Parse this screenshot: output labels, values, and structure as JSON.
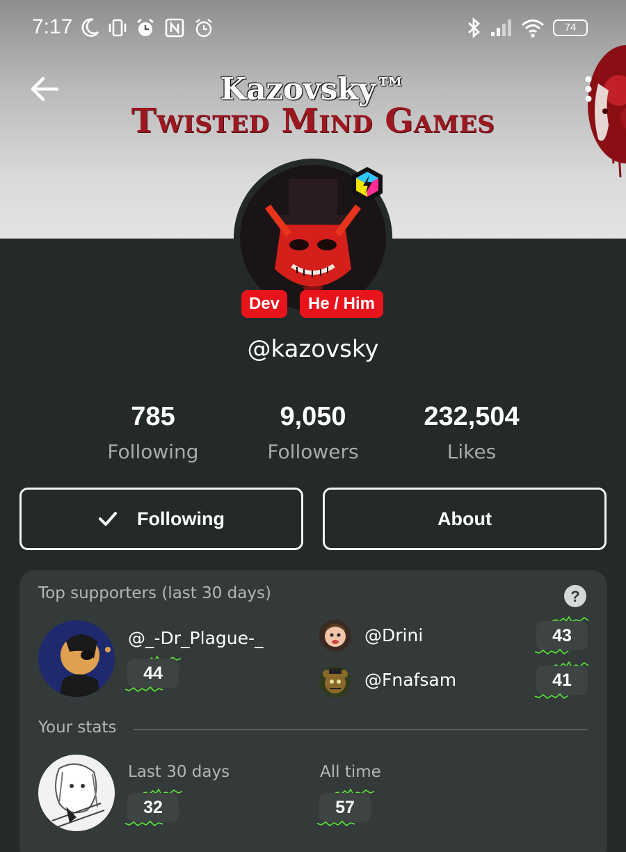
{
  "status_bar": {
    "time": "7:17",
    "battery": "74"
  },
  "banner": {
    "title": "Kazovsky™",
    "subtitle": "Twisted Mind Games"
  },
  "profile": {
    "tags": [
      "Dev",
      "He / Him"
    ],
    "handle": "@kazovsky"
  },
  "stats": [
    {
      "value": "785",
      "label": "Following"
    },
    {
      "value": "9,050",
      "label": "Followers"
    },
    {
      "value": "232,504",
      "label": "Likes"
    }
  ],
  "buttons": {
    "following": "Following",
    "about": "About"
  },
  "supporters": {
    "title": "Top supporters (last 30 days)",
    "top": {
      "name": "@_-Dr_Plague-_",
      "score": "44"
    },
    "others": [
      {
        "name": "@Drini",
        "score": "43"
      },
      {
        "name": "@Fnafsam",
        "score": "41"
      }
    ]
  },
  "your_stats": {
    "title": "Your stats",
    "last30_label": "Last 30 days",
    "last30_value": "32",
    "alltime_label": "All time",
    "alltime_value": "57"
  },
  "colors": {
    "accent_red": "#e8141c",
    "spark_green": "#5ee83a",
    "background": "#242a29",
    "card": "#333a39"
  }
}
